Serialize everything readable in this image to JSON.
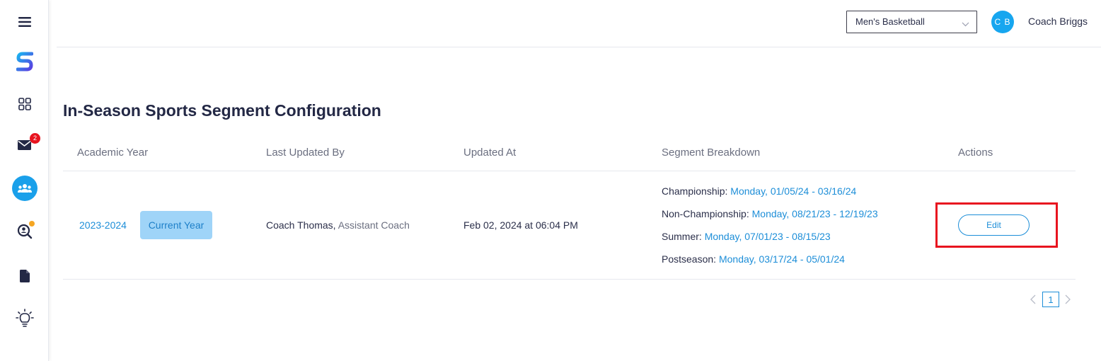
{
  "header": {
    "team_select": "Men's Basketball",
    "avatar_initials": "C B",
    "user_name": "Coach Briggs"
  },
  "sidebar": {
    "icons": [
      "menu-icon",
      "logo-icon",
      "dashboard-icon",
      "mail-icon",
      "team-icon",
      "search-user-icon",
      "document-icon",
      "lightbulb-icon"
    ],
    "mail_badge": "2"
  },
  "page": {
    "title": "In-Season Sports Segment Configuration"
  },
  "table": {
    "columns": [
      "Academic Year",
      "Last Updated By",
      "Updated At",
      "Segment Breakdown",
      "Actions"
    ],
    "rows": [
      {
        "academic_year": "2023-2024",
        "badge": "Current Year",
        "updated_by_name": "Coach Thomas,",
        "updated_by_role": "Assistant Coach",
        "updated_at": "Feb 02, 2024 at 06:04 PM",
        "segments": [
          {
            "label": "Championship:",
            "dates": "Monday, 01/05/24 - 03/16/24"
          },
          {
            "label": "Non-Championship:",
            "dates": "Monday, 08/21/23 - 12/19/23"
          },
          {
            "label": "Summer:",
            "dates": "Monday, 07/01/23 - 08/15/23"
          },
          {
            "label": "Postseason:",
            "dates": "Monday, 03/17/24 - 05/01/24"
          }
        ],
        "action_label": "Edit"
      }
    ]
  },
  "pagination": {
    "current_page": "1"
  },
  "colors": {
    "accent": "#1d8ed8",
    "highlight": "#e8141f",
    "badge_bg": "#9fd4f8"
  }
}
